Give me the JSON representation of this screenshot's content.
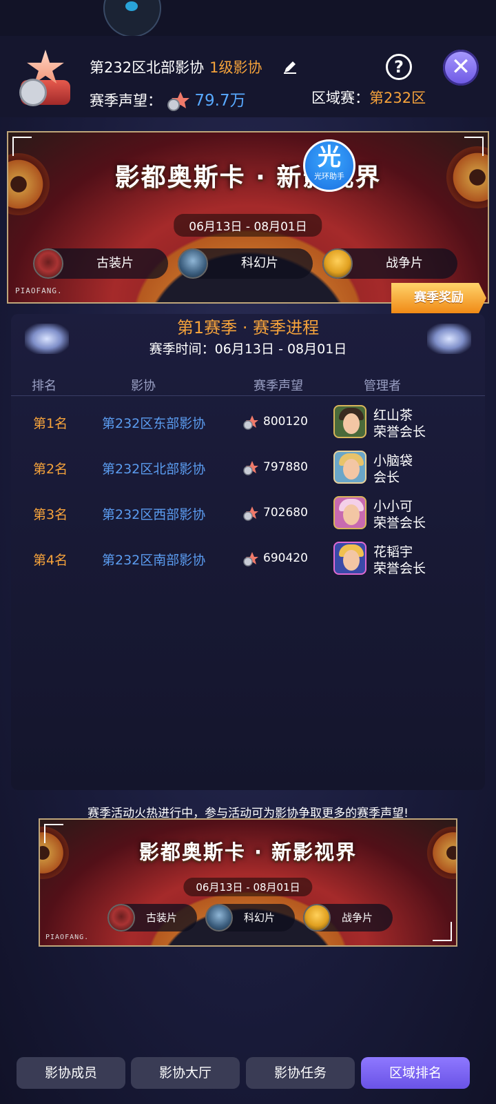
{
  "header": {
    "guild_name": "第232区北部影协",
    "guild_level": "1级影协",
    "prestige_label": "赛季声望：",
    "prestige_value": "79.7万",
    "region_label": "区域赛：",
    "region_value": "第232区",
    "help_symbol": "?",
    "close_symbol": "✕"
  },
  "banner": {
    "title": "影都奥斯卡 · 新影视界",
    "dates": "06月13日 - 08月01日",
    "genres": [
      "古装片",
      "科幻片",
      "战争片"
    ],
    "brand": "PIAOFANG.",
    "helper_badge_char": "光",
    "helper_badge_text": "光环助手",
    "reward_button": "赛季奖励"
  },
  "season": {
    "title": "第1赛季 · 赛季进程",
    "time": "赛季时间：06月13日 - 08月01日",
    "columns": [
      "排名",
      "影协",
      "赛季声望",
      "管理者"
    ],
    "rows": [
      {
        "rank": "第1名",
        "guild": "第232区东部影协",
        "prestige": "800120",
        "manager": "红山茶",
        "role": "荣誉会长"
      },
      {
        "rank": "第2名",
        "guild": "第232区北部影协",
        "prestige": "797880",
        "manager": "小脑袋",
        "role": "会长"
      },
      {
        "rank": "第3名",
        "guild": "第232区西部影协",
        "prestige": "702680",
        "manager": "小小可",
        "role": "荣誉会长"
      },
      {
        "rank": "第4名",
        "guild": "第232区南部影协",
        "prestige": "690420",
        "manager": "花韬宇",
        "role": "荣誉会长"
      }
    ]
  },
  "notice": "赛季活动火热进行中，参与活动可为影协争取更多的赛季声望!",
  "tabs": [
    "影协成员",
    "影协大厅",
    "影协任务",
    "区域排名"
  ],
  "active_tab": "区域排名",
  "colors": {
    "accent_orange": "#f6a33b",
    "link_blue": "#5b9cf0",
    "active_tab": "#7b66f0"
  },
  "icons": {
    "edit": "pencil-icon",
    "help": "help-icon",
    "close": "close-icon",
    "prestige": "star-reel-icon"
  }
}
